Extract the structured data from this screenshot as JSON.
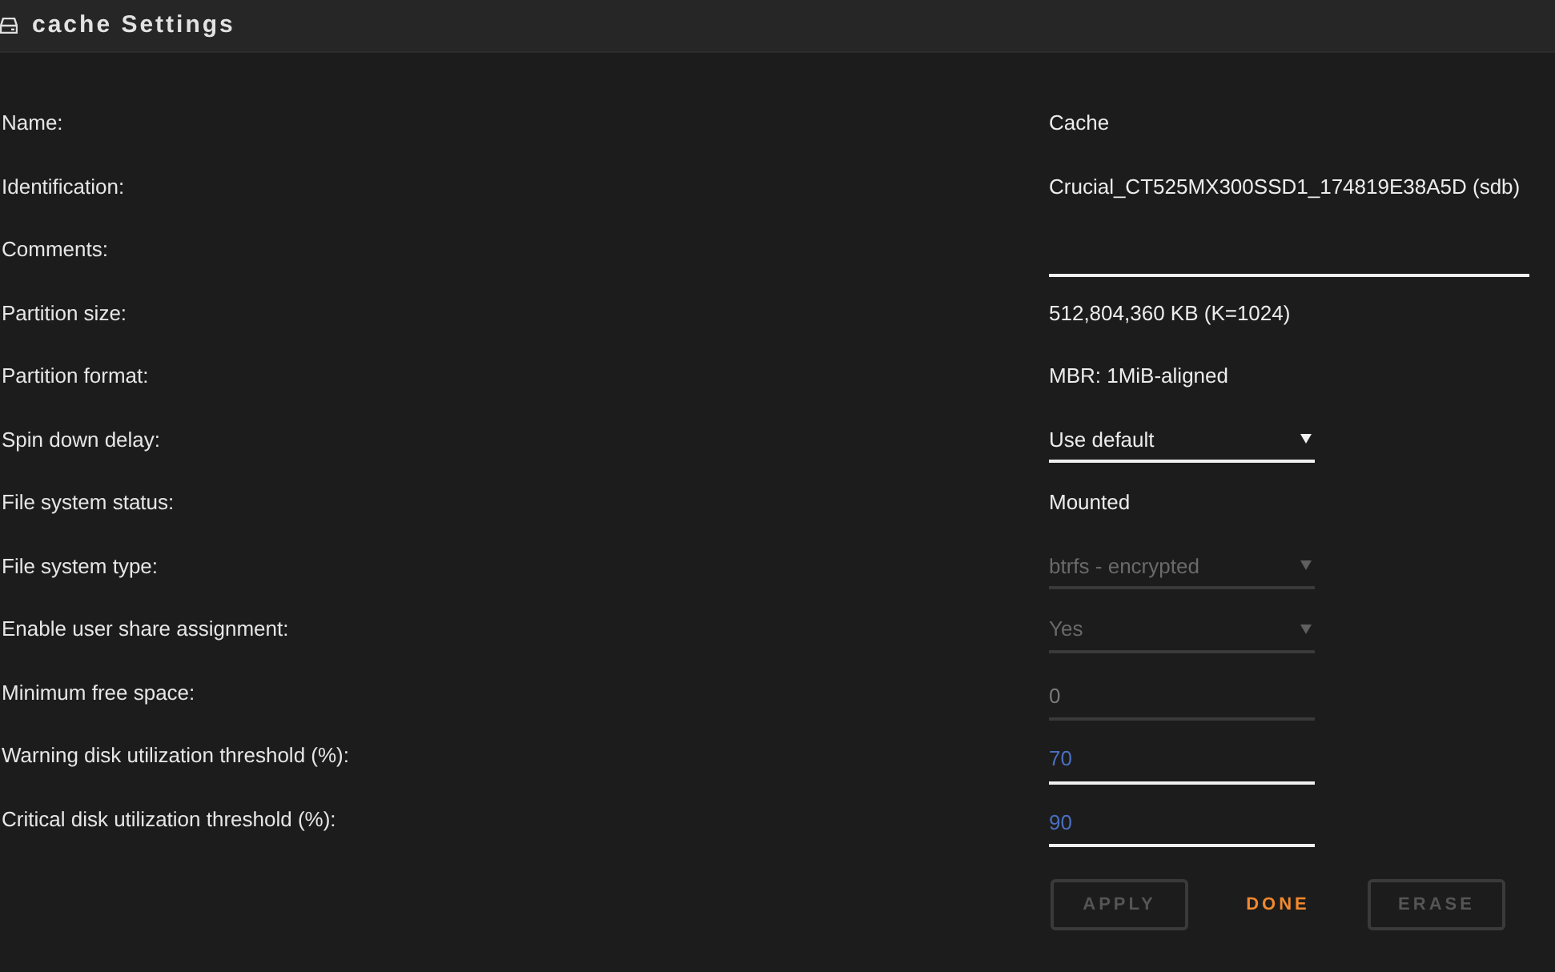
{
  "header": {
    "title": "cache Settings"
  },
  "fields": [
    {
      "label": "Name:",
      "kind": "text",
      "value": "Cache"
    },
    {
      "label": "Identification:",
      "kind": "text",
      "value": "Crucial_CT525MX300SSD1_174819E38A5D (sdb)"
    },
    {
      "label": "Comments:",
      "kind": "text_input",
      "disabled": false
    },
    {
      "label": "Partition size:",
      "kind": "text",
      "value": "512,804,360 KB (K=1024)"
    },
    {
      "label": "Partition format:",
      "kind": "text",
      "value": "MBR: 1MiB-aligned"
    },
    {
      "label": "Spin down delay:",
      "kind": "select",
      "value": "Use default",
      "disabled": false
    },
    {
      "label": "File system status:",
      "kind": "text",
      "value": "Mounted"
    },
    {
      "label": "File system type:",
      "kind": "select",
      "value": "btrfs - encrypted",
      "disabled": true
    },
    {
      "label": "Enable user share assignment:",
      "kind": "select",
      "value": "Yes",
      "disabled": true
    },
    {
      "label": "Minimum free space:",
      "kind": "number_input",
      "value": "0",
      "disabled": true
    },
    {
      "label": "Warning disk utilization threshold (%):",
      "kind": "number_input",
      "value": "70",
      "disabled": false
    },
    {
      "label": "Critical disk utilization threshold (%):",
      "kind": "number_input",
      "value": "90",
      "disabled": false
    }
  ],
  "buttons": [
    {
      "label": "APPLY",
      "disabled": true
    },
    {
      "label": "DONE",
      "disabled": false
    },
    {
      "label": "ERASE",
      "disabled": true
    }
  ]
}
